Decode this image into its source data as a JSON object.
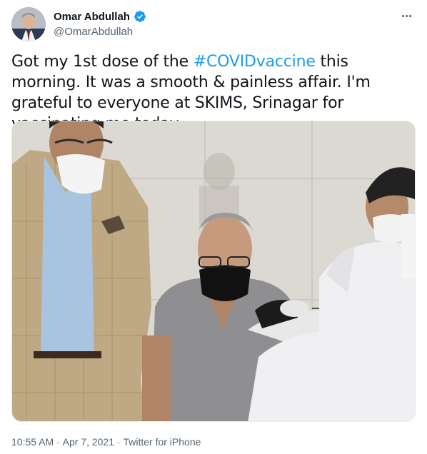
{
  "tweet": {
    "author": {
      "name": "Omar Abdullah",
      "handle": "@OmarAbdullah",
      "verified": true
    },
    "text": {
      "part1": "Got my 1st dose of the ",
      "hashtag": "#COVIDvaccine",
      "part2": " this morning. It was a smooth & painless affair. I'm grateful to everyone at SKIMS, Srinagar for vaccinating me today."
    },
    "meta": {
      "time": "10:55 AM",
      "separator1": " · ",
      "date": "Apr 7, 2021",
      "separator2": " · ",
      "source": "Twitter for iPhone"
    },
    "colors": {
      "link": "#1d9bf0",
      "secondary_text": "#536471",
      "verified_badge": "#1d9bf0"
    },
    "icons": [
      "verified-badge-icon",
      "more-options-icon"
    ]
  }
}
